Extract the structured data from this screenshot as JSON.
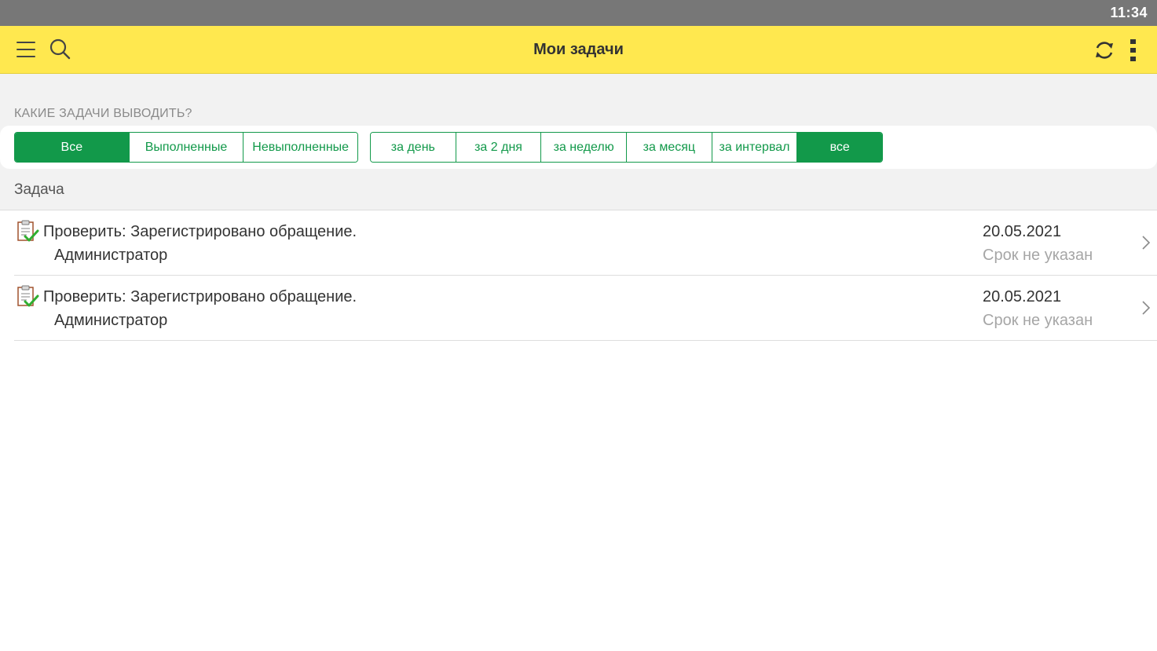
{
  "status_bar": {
    "time": "11:34"
  },
  "toolbar": {
    "title": "Мои задачи",
    "icons": [
      "menu-icon",
      "search-icon",
      "refresh-icon",
      "more-vertical-icon"
    ]
  },
  "filter": {
    "caption": "КАКИЕ ЗАДАЧИ ВЫВОДИТЬ?",
    "status_options": [
      "Все",
      "Выполненные",
      "Невыполненные"
    ],
    "status_selected": "Все",
    "period_options": [
      "за день",
      "за 2 дня",
      "за неделю",
      "за месяц",
      "за интервал",
      "все"
    ],
    "period_selected": "все"
  },
  "list": {
    "header": "Задача",
    "rows": [
      {
        "title": "Проверить: Зарегистрировано обращение.",
        "author": "Администратор",
        "date": "20.05.2021",
        "deadline": "Срок не указан",
        "icon": "task-check-icon"
      },
      {
        "title": "Проверить: Зарегистрировано обращение.",
        "author": "Администратор",
        "date": "20.05.2021",
        "deadline": "Срок не указан",
        "icon": "task-check-icon"
      }
    ]
  },
  "colors": {
    "toolbar": "#ffe84f",
    "accent": "#12994a",
    "status_bar": "#777777",
    "filter_background": "#f2f2f2"
  }
}
